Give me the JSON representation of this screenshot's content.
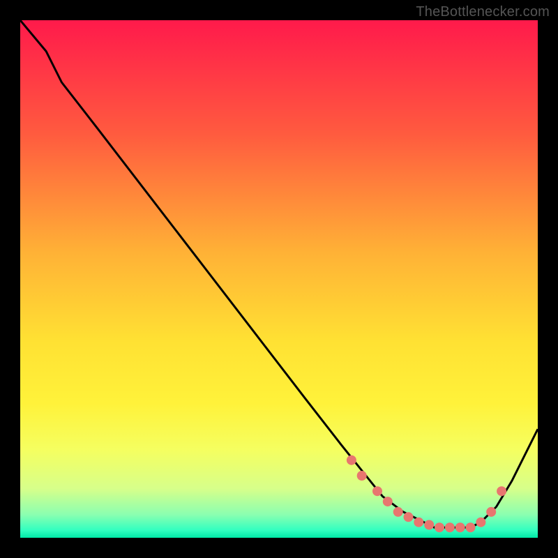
{
  "attribution": "TheBottlenecker.com",
  "colors": {
    "page_bg": "#000000",
    "attribution_text": "#555555",
    "curve": "#000000",
    "markers": "#e8766f",
    "gradient_stops": [
      {
        "offset": 0.0,
        "color": "#ff1a4b"
      },
      {
        "offset": 0.22,
        "color": "#ff5b3f"
      },
      {
        "offset": 0.45,
        "color": "#ffb236"
      },
      {
        "offset": 0.62,
        "color": "#ffe133"
      },
      {
        "offset": 0.74,
        "color": "#fff23a"
      },
      {
        "offset": 0.83,
        "color": "#f5ff60"
      },
      {
        "offset": 0.905,
        "color": "#d7ff8a"
      },
      {
        "offset": 0.955,
        "color": "#8bffb0"
      },
      {
        "offset": 0.985,
        "color": "#33ffc0"
      },
      {
        "offset": 1.0,
        "color": "#00e9a7"
      }
    ]
  },
  "chart_data": {
    "type": "line",
    "title": "",
    "xlabel": "",
    "ylabel": "",
    "xlim": [
      0,
      100
    ],
    "ylim": [
      0,
      100
    ],
    "grid": false,
    "legend": false,
    "series": [
      {
        "name": "bottleneck-curve",
        "x": [
          0,
          5,
          8,
          15,
          25,
          35,
          45,
          55,
          62,
          66,
          70,
          74,
          78,
          80,
          83,
          85,
          87,
          89,
          92,
          95,
          100
        ],
        "y": [
          100,
          94,
          88,
          79,
          66,
          53,
          40,
          27,
          18,
          13,
          8,
          5,
          3,
          2,
          2,
          2,
          2,
          3,
          6,
          11,
          21
        ]
      }
    ],
    "markers": {
      "name": "highlight-dots",
      "x": [
        64,
        66,
        69,
        71,
        73,
        75,
        77,
        79,
        81,
        83,
        85,
        87,
        89,
        91,
        93
      ],
      "y": [
        15,
        12,
        9,
        7,
        5,
        4,
        3,
        2.5,
        2,
        2,
        2,
        2,
        3,
        5,
        9
      ]
    }
  }
}
